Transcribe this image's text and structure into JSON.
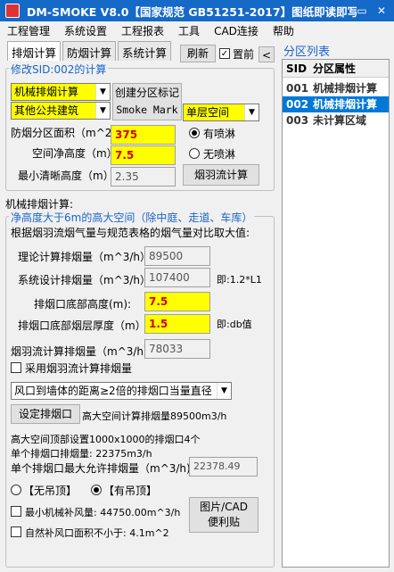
{
  "title": "DM-SMOKE V8.0【国家规范 GB51251-2017】图纸即读即写",
  "title_buttons": {
    "mini": "▭",
    "close": "✕"
  },
  "menu": [
    "工程管理",
    "系统设置",
    "工程报表",
    "工具",
    "CAD连接",
    "帮助"
  ],
  "tabs": [
    "排烟计算",
    "防烟计算",
    "系统计算"
  ],
  "refresh_label": "刷新",
  "pin_label": "置前",
  "collapse_label": "<",
  "section1_legend": "修改SID:002的计算",
  "system_type": "机械排烟计算",
  "building_type": "其他公共建筑",
  "space_type": "单层空间",
  "create_btn": "创建分区标记",
  "smoke_mark": "Smoke Mark",
  "area_label": "防烟分区面积（m^2)",
  "area_value": "375",
  "height_label": "空间净高度（m）",
  "height_value": "7.5",
  "min_clear_label": "最小清晰高度（m）",
  "min_clear_value": "2.35",
  "sprinkler_yes": "有喷淋",
  "sprinkler_no": "无喷淋",
  "plume_btn": "烟羽流计算",
  "mech_title": "机械排烟计算:",
  "section2_legend": "净高度大于6m的高大空间（除中庭、走道、车库）",
  "section2_note": "根据烟羽流烟气量与规范表格的烟气量对比取大值:",
  "theory_label": "理论计算排烟量（m^3/h）",
  "theory_value": "89500",
  "design_label": "系统设计排烟量（m^3/h）",
  "design_value": "107400",
  "design_note": "即:1.2*L1",
  "outlet_height_label": "排烟口底部高度(m):",
  "outlet_height_value": "7.5",
  "outlet_thick_label": "排烟口底部烟层厚度（m）",
  "outlet_thick_value": "1.5",
  "outlet_thick_note": "即:db值",
  "plume_flow_label": "烟羽流计算排烟量（m^3/h）:",
  "plume_flow_value": "78033",
  "use_plume_label": "采用烟羽流计算排烟量",
  "distance_select": "风口到墙体的距离≥2倍的排烟口当量直径",
  "set_outlet_btn": "设定排烟口",
  "space_calc_text": "高大空间计算排烟量89500m3/h",
  "outlet_setup_text": "高大空间顶部设置1000x1000的排烟口4个",
  "single_outlet_text": "单个排烟口排烟量: 22375m3/h",
  "single_max_label": "单个排烟口最大允许排烟量（m^3/h)",
  "single_max_value": "22378.49",
  "no_ceiling": "【无吊顶】",
  "with_ceiling": "【有吊顶】",
  "min_mech_label": "最小机械补风量: 44750.00m^3/h",
  "natural_label": "自然补风口面积不小于: 4.1m^2",
  "image_cad_btn": "图片/CAD 便利贴",
  "right_title": "分区列表",
  "list_headers": {
    "sid": "SID",
    "attr": "分区属性"
  },
  "list_rows": [
    {
      "sid": "001",
      "attr": "机械排烟计算"
    },
    {
      "sid": "002",
      "attr": "机械排烟计算"
    },
    {
      "sid": "003",
      "attr": "未计算区域"
    }
  ],
  "colors": {
    "accent": "#1569c7",
    "highlight": "#ffff00",
    "selected": "#0078d7",
    "legend": "#1a64c8"
  }
}
